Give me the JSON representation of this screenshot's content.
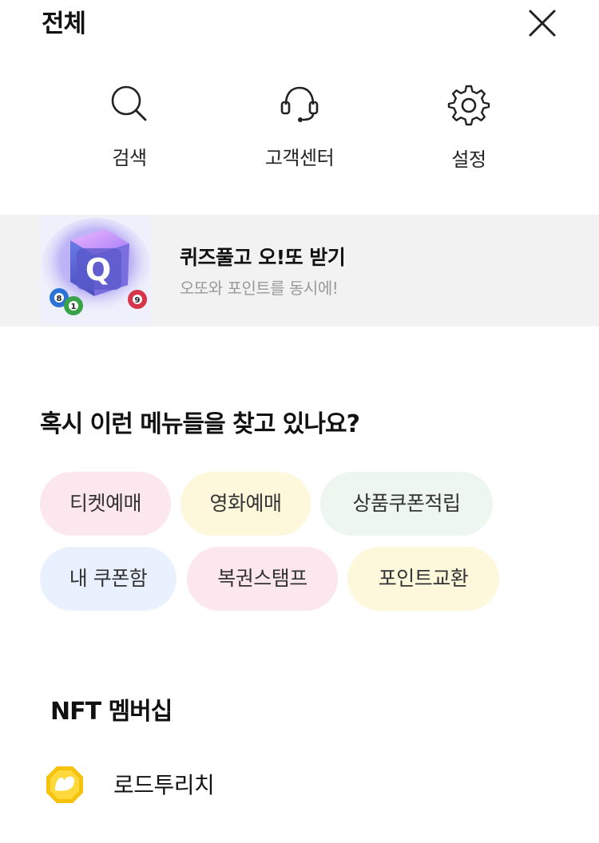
{
  "header": {
    "title": "전체"
  },
  "quick_menu": [
    {
      "label": "검색",
      "icon": "search-icon"
    },
    {
      "label": "고객센터",
      "icon": "headset-icon"
    },
    {
      "label": "설정",
      "icon": "gear-icon"
    }
  ],
  "banner": {
    "title": "퀴즈풀고 오!또 받기",
    "subtitle": "오또와 포인트를 동시에!",
    "image_letter": "Q",
    "ball_numbers": [
      "8",
      "1",
      "9"
    ]
  },
  "suggestions": {
    "title": "혹시 이런 메뉴들을 찾고 있나요?",
    "chips": [
      {
        "label": "티켓예매",
        "color": "#fde7ee"
      },
      {
        "label": "영화예매",
        "color": "#fdf8dc"
      },
      {
        "label": "상품쿠폰적립",
        "color": "#edf6ef"
      },
      {
        "label": "내 쿠폰함",
        "color": "#e8f1fd"
      },
      {
        "label": "복권스탬프",
        "color": "#fde7ee"
      },
      {
        "label": "포인트교환",
        "color": "#fdf8dc"
      }
    ]
  },
  "nft": {
    "title": "NFT 멤버십",
    "items": [
      {
        "label": "로드투리치",
        "icon": "road-to-rich-icon"
      }
    ]
  }
}
